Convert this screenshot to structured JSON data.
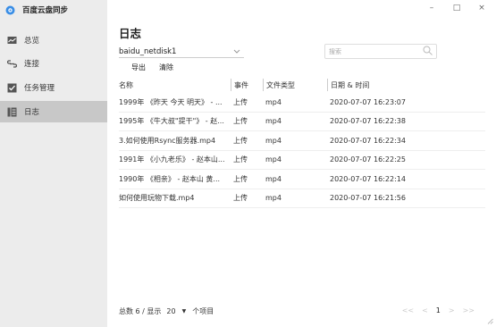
{
  "app": {
    "title": "百度云盘同步"
  },
  "sidebar": {
    "items": [
      {
        "label": "总览",
        "icon": "overview-icon"
      },
      {
        "label": "连接",
        "icon": "link-icon"
      },
      {
        "label": "任务管理",
        "icon": "task-icon"
      },
      {
        "label": "日志",
        "icon": "log-icon",
        "active": true
      }
    ]
  },
  "window": {
    "minimize": "–",
    "maximize": "□",
    "close": "×"
  },
  "page": {
    "title": "日志"
  },
  "filter": {
    "disk": "baidu_netdisk1",
    "search_placeholder": "搜索"
  },
  "toolbar": {
    "export_label": "导出",
    "clear_label": "清除"
  },
  "table": {
    "headers": {
      "name": "名称",
      "event": "事件",
      "type": "文件类型",
      "date": "日期 & 时间"
    },
    "rows": [
      {
        "name": "1999年 《昨天 今天 明天》 - ...",
        "event": "上传",
        "type": "mp4",
        "date": "2020-07-07 16:23:07"
      },
      {
        "name": "1995年 《牛大叔\"提干\"》 - 赵...",
        "event": "上传",
        "type": "mp4",
        "date": "2020-07-07 16:22:38"
      },
      {
        "name": "3.如何使用Rsync服务器.mp4",
        "event": "上传",
        "type": "mp4",
        "date": "2020-07-07 16:22:34"
      },
      {
        "name": "1991年 《小九老乐》 - 赵本山...",
        "event": "上传",
        "type": "mp4",
        "date": "2020-07-07 16:22:25"
      },
      {
        "name": "1990年 《相亲》 - 赵本山 黄...",
        "event": "上传",
        "type": "mp4",
        "date": "2020-07-07 16:22:14"
      },
      {
        "name": "如何使用玩物下载.mp4",
        "event": "上传",
        "type": "mp4",
        "date": "2020-07-07 16:21:56"
      }
    ]
  },
  "footer": {
    "summary": "总数 6 / 显示",
    "page_size": "20",
    "suffix": "个项目"
  },
  "pagination": {
    "first": "<<",
    "prev": "<",
    "current": "1",
    "next": ">",
    "last": ">>"
  },
  "colors": {
    "sidebar_bg": "#ececec",
    "active_bg": "#c8c8c8",
    "logo_blue": "#3a8ee6"
  }
}
